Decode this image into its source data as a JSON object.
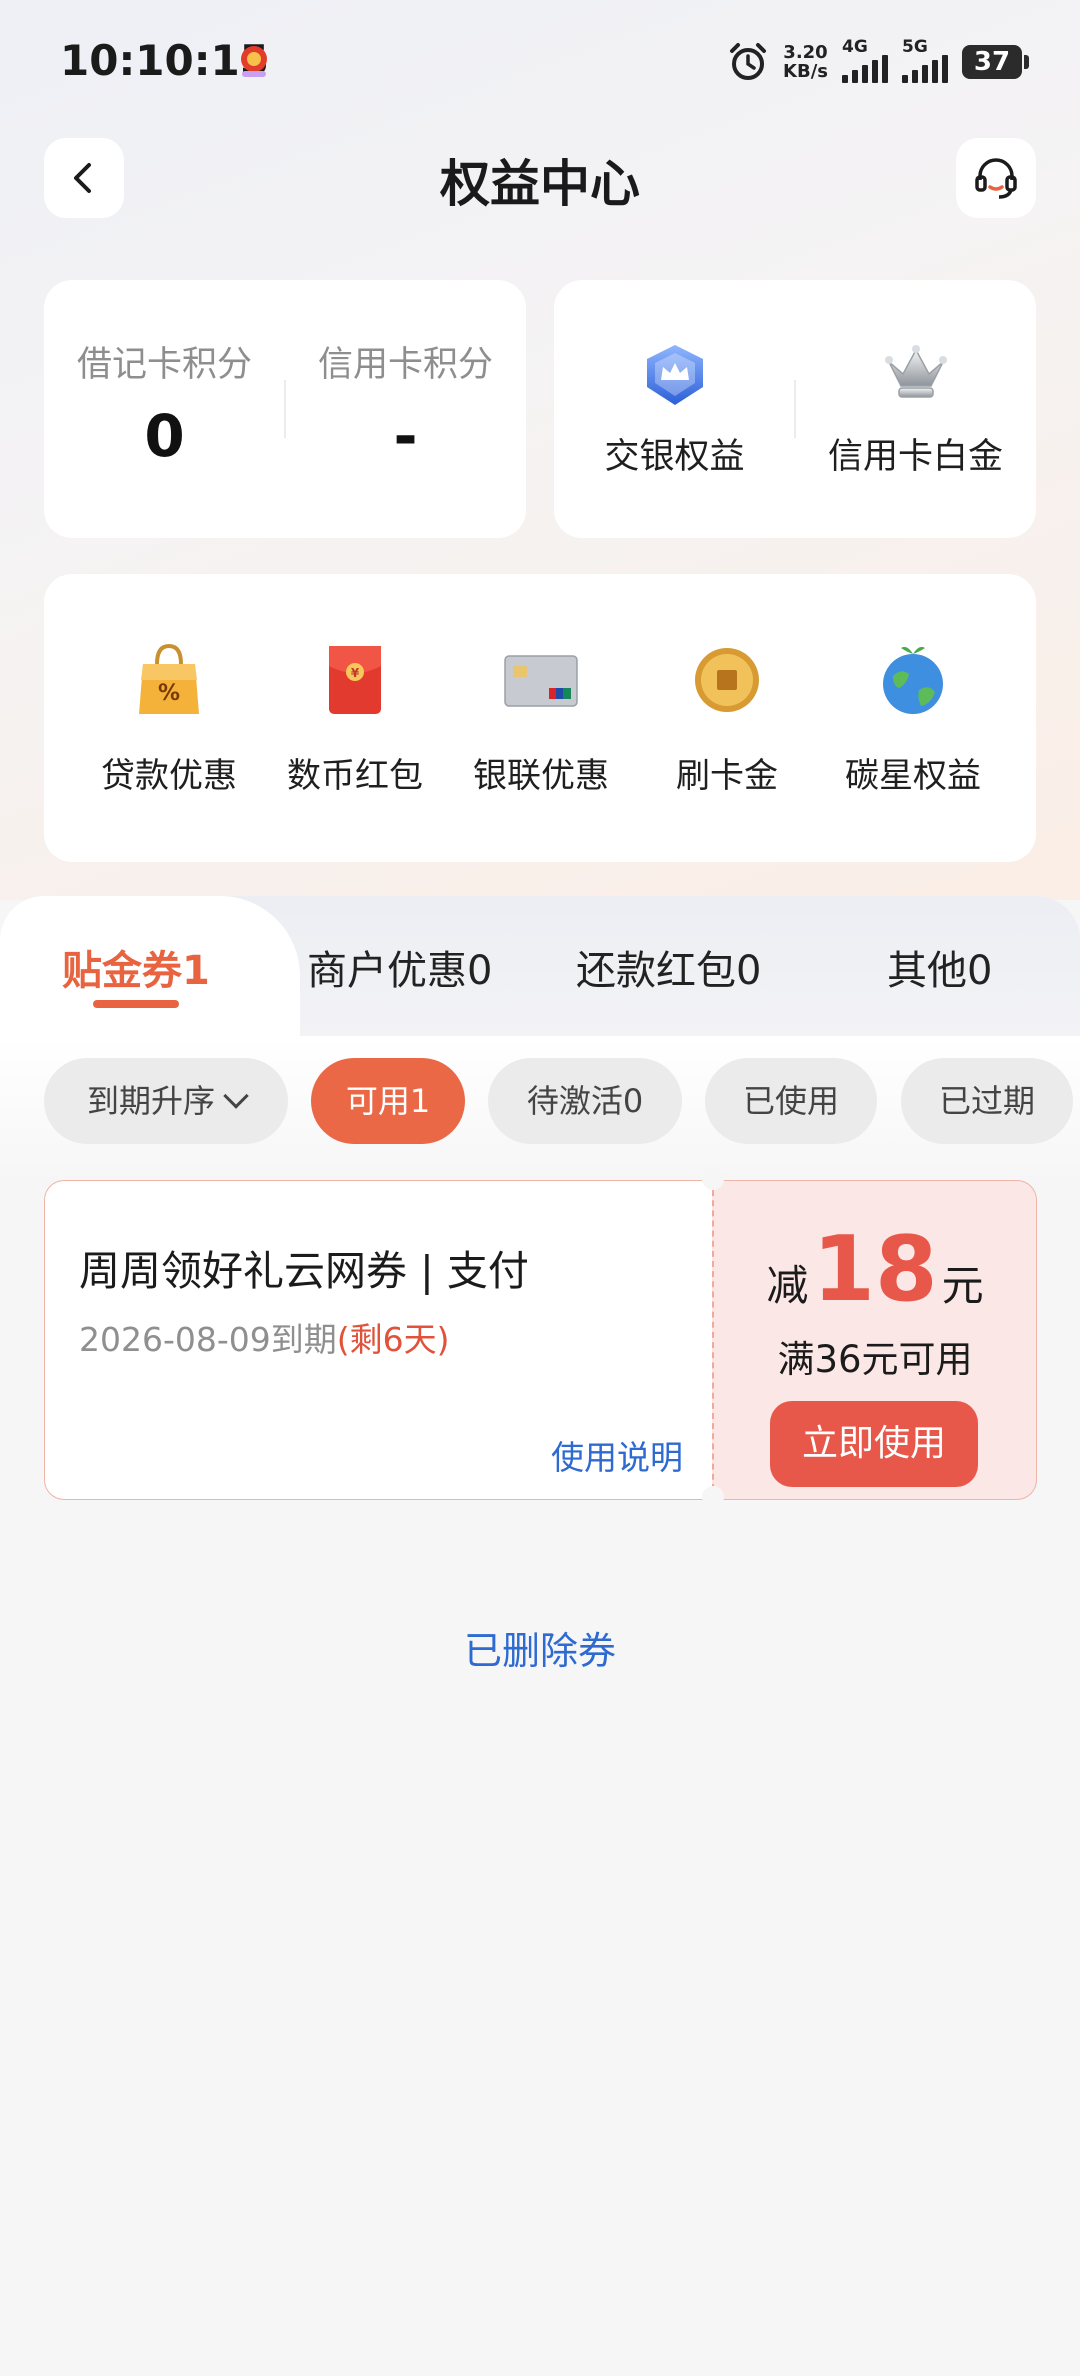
{
  "status_bar": {
    "time": "10:10:15",
    "net_speed_value": "3.20",
    "net_speed_unit": "KB/s",
    "signal1_label": "4G",
    "signal2_label": "5G",
    "battery": "37"
  },
  "header": {
    "title": "权益中心",
    "back_icon": "chevron-left-icon",
    "support_icon": "headset-icon"
  },
  "points": {
    "debit_label": "借记卡积分",
    "debit_value": "0",
    "credit_label": "信用卡积分",
    "credit_value": "-"
  },
  "benefits": {
    "bocom_label": "交银权益",
    "credit_platinum_label": "信用卡白金"
  },
  "shortcuts": [
    {
      "label": "贷款优惠",
      "icon": "shopping-bag-icon"
    },
    {
      "label": "数币红包",
      "icon": "red-envelope-icon"
    },
    {
      "label": "银联优惠",
      "icon": "bank-card-icon"
    },
    {
      "label": "刷卡金",
      "icon": "gold-coin-icon"
    },
    {
      "label": "碳星权益",
      "icon": "globe-icon"
    }
  ],
  "tabs": [
    "贴金券1",
    "商户优惠0",
    "还款红包0",
    "其他0"
  ],
  "filters": {
    "sort_label": "到期升序",
    "chips": [
      "可用1",
      "待激活0",
      "已使用",
      "已过期"
    ]
  },
  "coupon": {
    "title": "周周领好礼云网券 | 支付",
    "expiry": "2026-08-09到期",
    "remaining": "(剩6天)",
    "usage_link": "使用说明",
    "prefix": "减",
    "amount": "18",
    "unit": "元",
    "condition": "满36元可用",
    "use_button": "立即使用"
  },
  "deleted_link": "已删除券",
  "colors": {
    "accent": "#e8633f",
    "coupon_red": "#e8584a",
    "link_blue": "#2f6ad0"
  }
}
